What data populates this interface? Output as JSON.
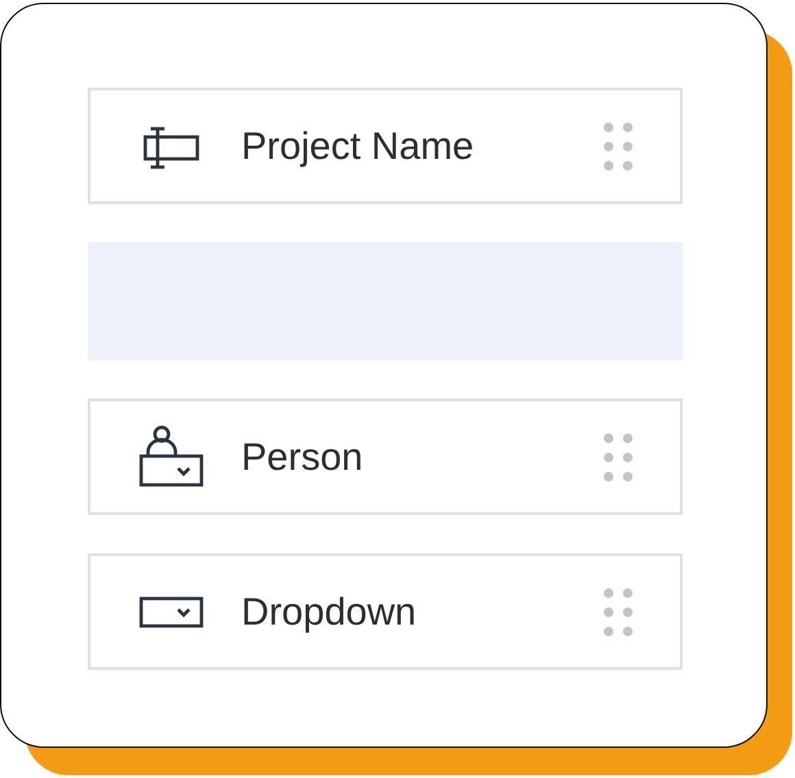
{
  "fields": [
    {
      "kind": "text",
      "label": "Project Name"
    },
    {
      "kind": "placeholder"
    },
    {
      "kind": "person",
      "label": "Person"
    },
    {
      "kind": "dropdown",
      "label": "Dropdown"
    }
  ]
}
